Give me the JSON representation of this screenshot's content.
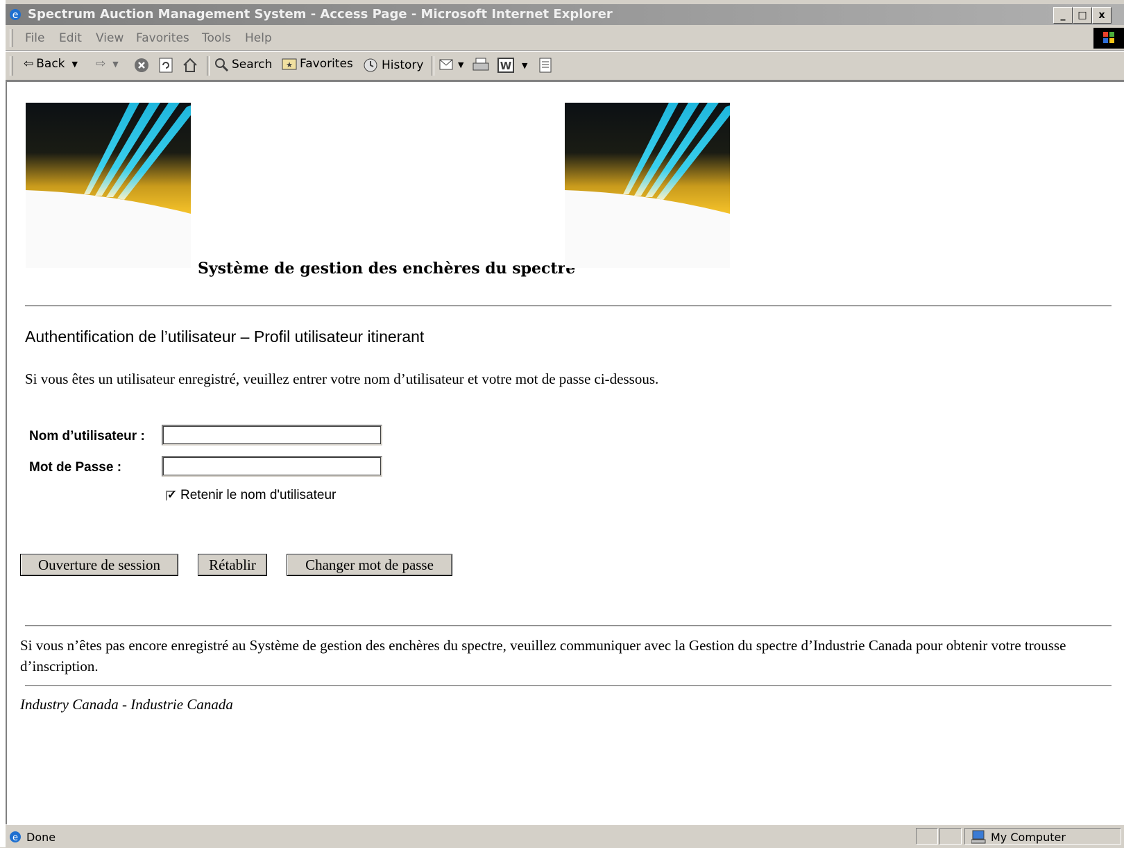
{
  "window": {
    "title": "Spectrum Auction Management System - Access Page - Microsoft Internet Explorer",
    "min": "_",
    "max": "□",
    "close": "x"
  },
  "menu": [
    "File",
    "Edit",
    "View",
    "Favorites",
    "Tools",
    "Help"
  ],
  "toolbar": {
    "back": "Back",
    "search": "Search",
    "favorites": "Favorites",
    "history": "History"
  },
  "page": {
    "system_name": "Système de gestion des enchères du spectre",
    "heading": "Authentification de l’utilisateur – Profil utilisateur itinerant",
    "intro": "Si vous êtes un utilisateur enregistré, veuillez entrer votre nom d’utilisateur et votre mot de passe ci-dessous.",
    "username_label": "Nom d’utilisateur :",
    "username_value": "",
    "password_label": "Mot de Passe :",
    "password_value": "",
    "remember_label": "Retenir le nom d'utilisateur",
    "remember_checked": true,
    "btn_login": "Ouverture de session",
    "btn_reset": "Rétablir",
    "btn_change": "Changer mot de passe",
    "footnote": "Si vous n’êtes pas encore enregistré au Système de gestion des enchères du spectre, veuillez communiquer avec la Gestion du spectre d’Industrie Canada pour obtenir votre trousse d’inscription.",
    "copyright": "Industry Canada - Industrie Canada"
  },
  "status": {
    "text": "Done",
    "zone": "My Computer"
  },
  "colors": {
    "logo_ray": "#29c4e6",
    "logo_glow": "#f5b921",
    "chrome": "#d4d0c8"
  }
}
